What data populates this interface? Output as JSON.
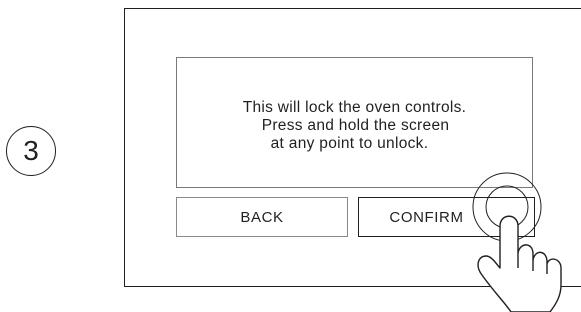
{
  "step": {
    "number": "3"
  },
  "dialog": {
    "message_lines": [
      "This will lock the oven controls.",
      "Press and hold the screen",
      "at any point to unlock."
    ],
    "buttons": {
      "back_label": "BACK",
      "confirm_label": "CONFIRM"
    }
  },
  "icons": {
    "touch": "hand-tap-icon"
  },
  "colors": {
    "stroke": "#231f20",
    "background": "#ffffff",
    "light_border": "#8a8a8a"
  }
}
